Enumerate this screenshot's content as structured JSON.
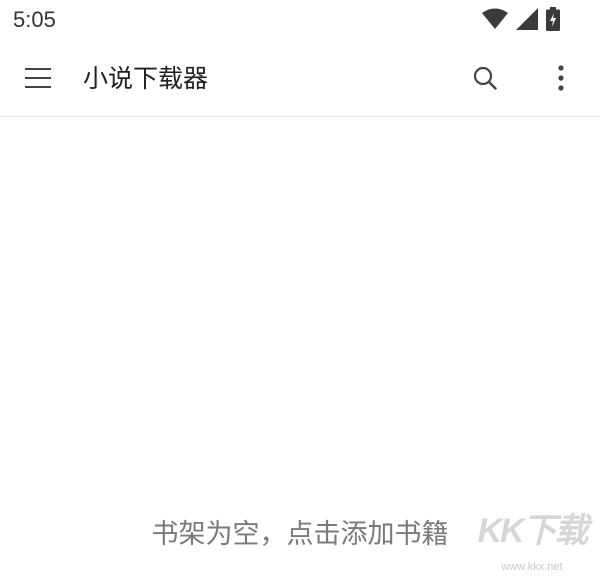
{
  "status_bar": {
    "time": "5:05",
    "icons": [
      "wifi-icon",
      "signal-icon",
      "battery-charging-icon"
    ]
  },
  "app_bar": {
    "title": "小说下载器",
    "icons": [
      "menu-icon",
      "search-icon",
      "more-vertical-icon"
    ]
  },
  "content": {
    "empty_message": "书架为空，点击添加书籍"
  },
  "watermark": {
    "logo_text": "KK下载",
    "url": "www.kkx.net"
  },
  "colors": {
    "background": "#ffffff",
    "title_text": "#222222",
    "hint_text": "#7a7a7a",
    "icon": "#444444",
    "divider": "#e2e2e2"
  }
}
